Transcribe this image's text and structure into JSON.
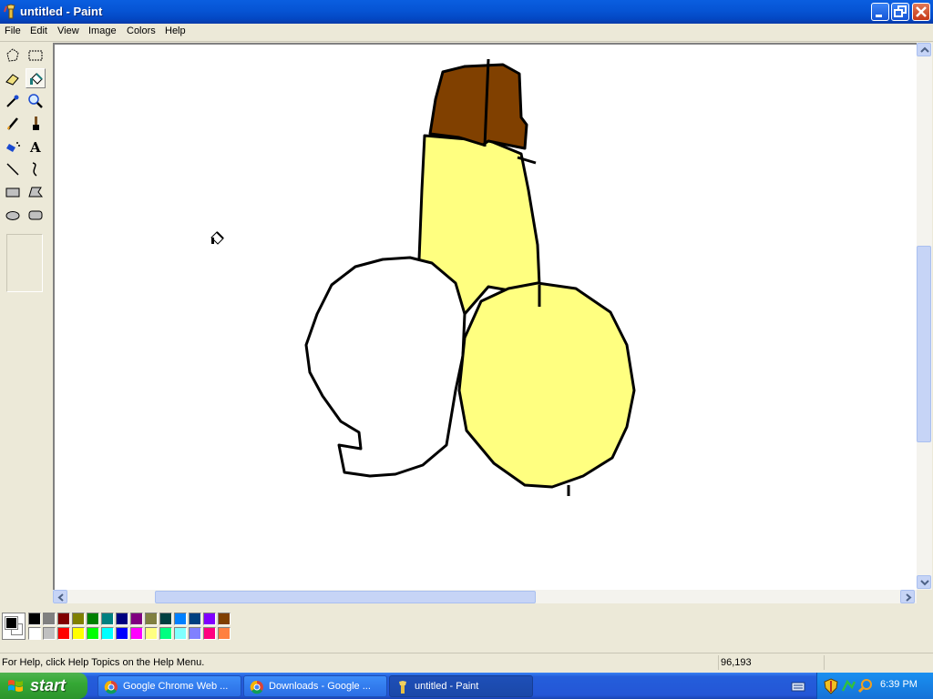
{
  "window": {
    "title": "untitled - Paint",
    "controls": [
      "minimize",
      "maximize",
      "close"
    ]
  },
  "menu": [
    {
      "label": "File"
    },
    {
      "label": "Edit"
    },
    {
      "label": "View"
    },
    {
      "label": "Image"
    },
    {
      "label": "Colors"
    },
    {
      "label": "Help"
    }
  ],
  "toolbox": {
    "tools": [
      {
        "name": "free-form-select",
        "icon": "free-select-icon"
      },
      {
        "name": "select",
        "icon": "rect-select-icon"
      },
      {
        "name": "eraser",
        "icon": "eraser-icon"
      },
      {
        "name": "fill-with-color",
        "icon": "paint-bucket-icon",
        "selected": true
      },
      {
        "name": "pick-color",
        "icon": "eyedropper-icon"
      },
      {
        "name": "magnifier",
        "icon": "magnifier-icon"
      },
      {
        "name": "pencil",
        "icon": "pencil-icon"
      },
      {
        "name": "brush",
        "icon": "brush-icon"
      },
      {
        "name": "airbrush",
        "icon": "airbrush-icon"
      },
      {
        "name": "text",
        "icon": "text-icon",
        "glyph": "A"
      },
      {
        "name": "line",
        "icon": "line-icon"
      },
      {
        "name": "curve",
        "icon": "curve-icon"
      },
      {
        "name": "rectangle",
        "icon": "rectangle-icon"
      },
      {
        "name": "polygon",
        "icon": "polygon-icon"
      },
      {
        "name": "ellipse",
        "icon": "ellipse-icon"
      },
      {
        "name": "rounded-rectangle",
        "icon": "rounded-rect-icon"
      }
    ]
  },
  "palette": {
    "foreground": "#000000",
    "background": "#ffffff",
    "top_row": [
      "#000000",
      "#808080",
      "#800000",
      "#808000",
      "#008000",
      "#008080",
      "#000080",
      "#800080",
      "#808040",
      "#004040",
      "#0080ff",
      "#004080",
      "#8000ff",
      "#804000"
    ],
    "bottom_row": [
      "#ffffff",
      "#c0c0c0",
      "#ff0000",
      "#ffff00",
      "#00ff00",
      "#00ffff",
      "#0000ff",
      "#ff00ff",
      "#ffff80",
      "#00ff80",
      "#80ffff",
      "#8080ff",
      "#ff0080",
      "#ff8040"
    ]
  },
  "canvas": {
    "drawing_colors": {
      "outline": "#000000",
      "cap_fill": "#804000",
      "body_fill": "#ffff80",
      "left_circle_fill": "#ffffff"
    }
  },
  "status": {
    "help_text": "For Help, click Help Topics on the Help Menu.",
    "coordinates": "96,193"
  },
  "taskbar": {
    "start_label": "start",
    "items": [
      {
        "label": "Google Chrome Web ...",
        "icon": "chrome-icon",
        "active": false
      },
      {
        "label": "Downloads - Google ...",
        "icon": "chrome-icon",
        "active": false
      },
      {
        "label": "untitled - Paint",
        "icon": "paint-icon",
        "active": true
      }
    ],
    "tray_icons": [
      "keyboard-icon",
      "shield-icon",
      "network-icon",
      "search-icon"
    ],
    "clock": "6:39 PM"
  }
}
